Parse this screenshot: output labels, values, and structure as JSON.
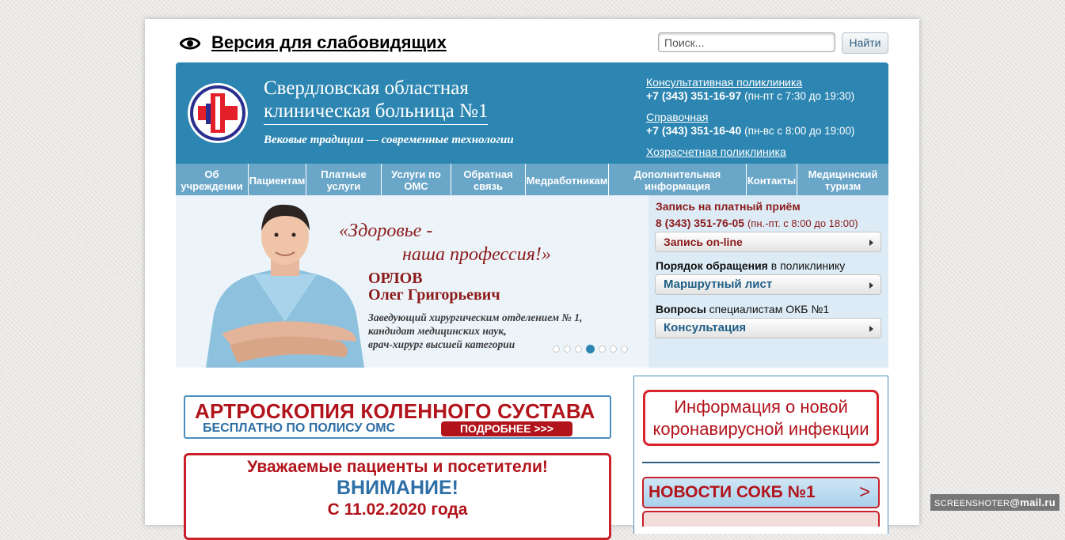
{
  "top": {
    "vision_link": "Версия для слабовидящих",
    "search_placeholder": "Поиск...",
    "search_button": "Найти"
  },
  "header": {
    "title_line1": "Свердловская областная",
    "title_line2": "клиническая больница №1",
    "slogan": "Вековые традиции — современные технологии",
    "contacts": [
      {
        "label": "Консультативная поликлиника",
        "phone": "+7 (343) 351-16-97",
        "hours": "(пн-пт с 7:30 до 19:30)"
      },
      {
        "label": "Справочная",
        "phone": "+7 (343) 351-16-40",
        "hours": "(пн-вс с 8:00 до 19:00)"
      },
      {
        "label": "Хозрасчетная поликлиника"
      }
    ]
  },
  "nav": [
    {
      "label": "Об учреждении"
    },
    {
      "label": "Пациентам"
    },
    {
      "label": "Платные услуги"
    },
    {
      "label": "Услуги по ОМС"
    },
    {
      "label": "Обратная связь"
    },
    {
      "label": "Медработникам"
    },
    {
      "label": "Дополнительная информация"
    },
    {
      "label": "Контакты"
    },
    {
      "label": "Медицинский туризм"
    }
  ],
  "banner": {
    "quote_line1": "«Здоровье -",
    "quote_line2": "наша профессия!»",
    "name_line1": "ОРЛОВ",
    "name_line2": "Олег Григорьевич",
    "desc_line1": "Заведующий хирургическим отделением № 1,",
    "desc_line2": "кандидат медицинских наук,",
    "desc_line3": "врач-хирург высшей категории",
    "slides_total": 7,
    "slide_active": 4
  },
  "sidebar": {
    "paid_title": "Запись на платный приём",
    "paid_phone": "8 (343) 351-76-05",
    "paid_hours": "(пн.-пт. с 8:00 до 18:00)",
    "online_button": "Запись on-line",
    "order_bold": "Порядок обращения",
    "order_rest": " в поликлинику",
    "route_button": "Маршрутный лист",
    "questions_bold": "Вопросы",
    "questions_rest": " специалистам ОКБ №1",
    "consult_button": "Консультация"
  },
  "promo": {
    "title": "АРТРОСКОПИЯ КОЛЕННОГО СУСТАВА",
    "subtitle": "БЕСПЛАТНО ПО ПОЛИСУ ОМС",
    "more": "ПОДРОБНЕЕ >>>"
  },
  "notice": {
    "line1": "Уважаемые пациенты и посетители!",
    "line2": "ВНИМАНИЕ!",
    "line3": "С 11.02.2020 года"
  },
  "right": {
    "covid_line1": "Информация о новой",
    "covid_line2": "коронавирусной инфекции",
    "news_label": "НОВОСТИ СОКБ №1",
    "news_arrow": ">"
  },
  "watermark": {
    "left": "SCREENSHOTER",
    "right": "@mail.ru"
  },
  "colors": {
    "header_blue": "#2d86b2",
    "nav_blue": "#6aa6c8",
    "brand_red": "#b2141c",
    "sidebar_bg": "#dcebf5"
  }
}
